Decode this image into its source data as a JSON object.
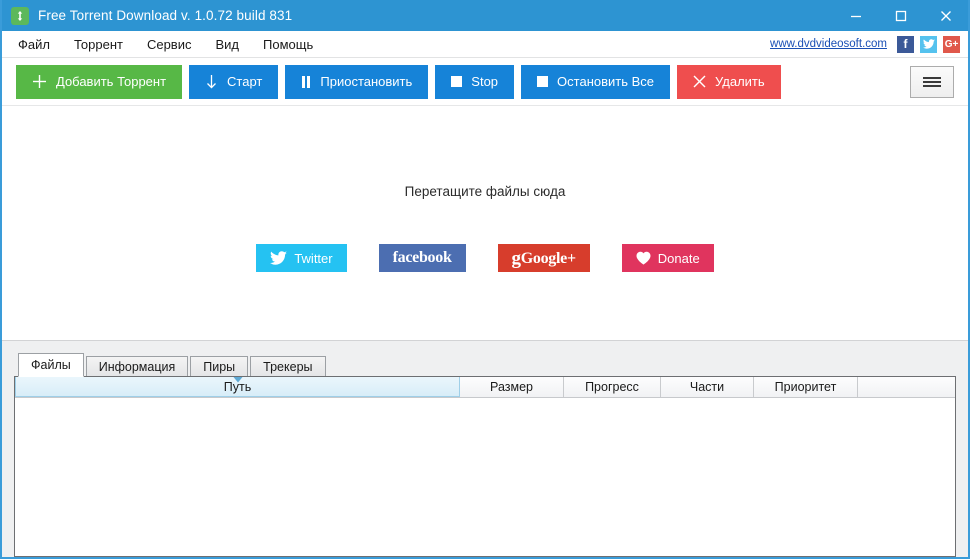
{
  "window": {
    "title": "Free Torrent Download v. 1.0.72 build 831",
    "app_icon": "torrent-arrows-icon",
    "accent_color": "#2d94d2",
    "controls": {
      "minimize": "minimize-icon",
      "maximize": "maximize-icon",
      "close": "close-icon"
    }
  },
  "menubar": {
    "items": [
      {
        "label": "Файл"
      },
      {
        "label": "Торрент"
      },
      {
        "label": "Сервис"
      },
      {
        "label": "Вид"
      },
      {
        "label": "Помощь"
      }
    ],
    "site_link": "www.dvdvideosoft.com",
    "social": [
      {
        "name": "facebook",
        "glyph": "f",
        "color": "#3b5998"
      },
      {
        "name": "twitter",
        "glyph": "twitter-bird-icon",
        "color": "#55c2ee"
      },
      {
        "name": "googleplus",
        "glyph": "G+",
        "color": "#e0584b"
      }
    ]
  },
  "toolbar": {
    "buttons": [
      {
        "label": "Добавить Торрент",
        "icon": "plus-icon",
        "style": "tb-green"
      },
      {
        "label": "Старт",
        "icon": "arrow-down-icon",
        "style": "tb-blue"
      },
      {
        "label": "Приостановить",
        "icon": "pause-icon",
        "style": "tb-blue"
      },
      {
        "label": "Stop",
        "icon": "stop-square-icon",
        "style": "tb-blue"
      },
      {
        "label": "Остановить Все",
        "icon": "stop-square-icon",
        "style": "tb-blue"
      },
      {
        "label": "Удалить",
        "icon": "close-x-icon",
        "style": "tb-red"
      }
    ],
    "menu_button": "hamburger-menu-icon"
  },
  "main": {
    "drop_hint": "Перетащите файлы сюда",
    "social_buttons": [
      {
        "label": "Twitter",
        "icon": "twitter-bird-icon",
        "style": "soc-tw",
        "color": "#25c2f2"
      },
      {
        "label": "facebook",
        "icon": "facebook-wordmark-icon",
        "style": "soc-fb",
        "color": "#4c6eb1"
      },
      {
        "label": "Google+",
        "icon": "googleplus-wordmark-icon",
        "style": "soc-gp",
        "color": "#d73d2c"
      },
      {
        "label": "Donate",
        "icon": "heart-icon",
        "style": "soc-dn",
        "color": "#e0345e"
      }
    ]
  },
  "bottom": {
    "tabs": [
      {
        "label": "Файлы",
        "active": true
      },
      {
        "label": "Информация",
        "active": false
      },
      {
        "label": "Пиры",
        "active": false
      },
      {
        "label": "Трекеры",
        "active": false
      }
    ],
    "table": {
      "columns": [
        {
          "label": "Путь",
          "sorted": true,
          "sort_dir": "asc"
        },
        {
          "label": "Размер",
          "sorted": false
        },
        {
          "label": "Прогресс",
          "sorted": false
        },
        {
          "label": "Части",
          "sorted": false
        },
        {
          "label": "Приоритет",
          "sorted": false
        },
        {
          "label": "",
          "sorted": false
        }
      ],
      "rows": []
    }
  }
}
